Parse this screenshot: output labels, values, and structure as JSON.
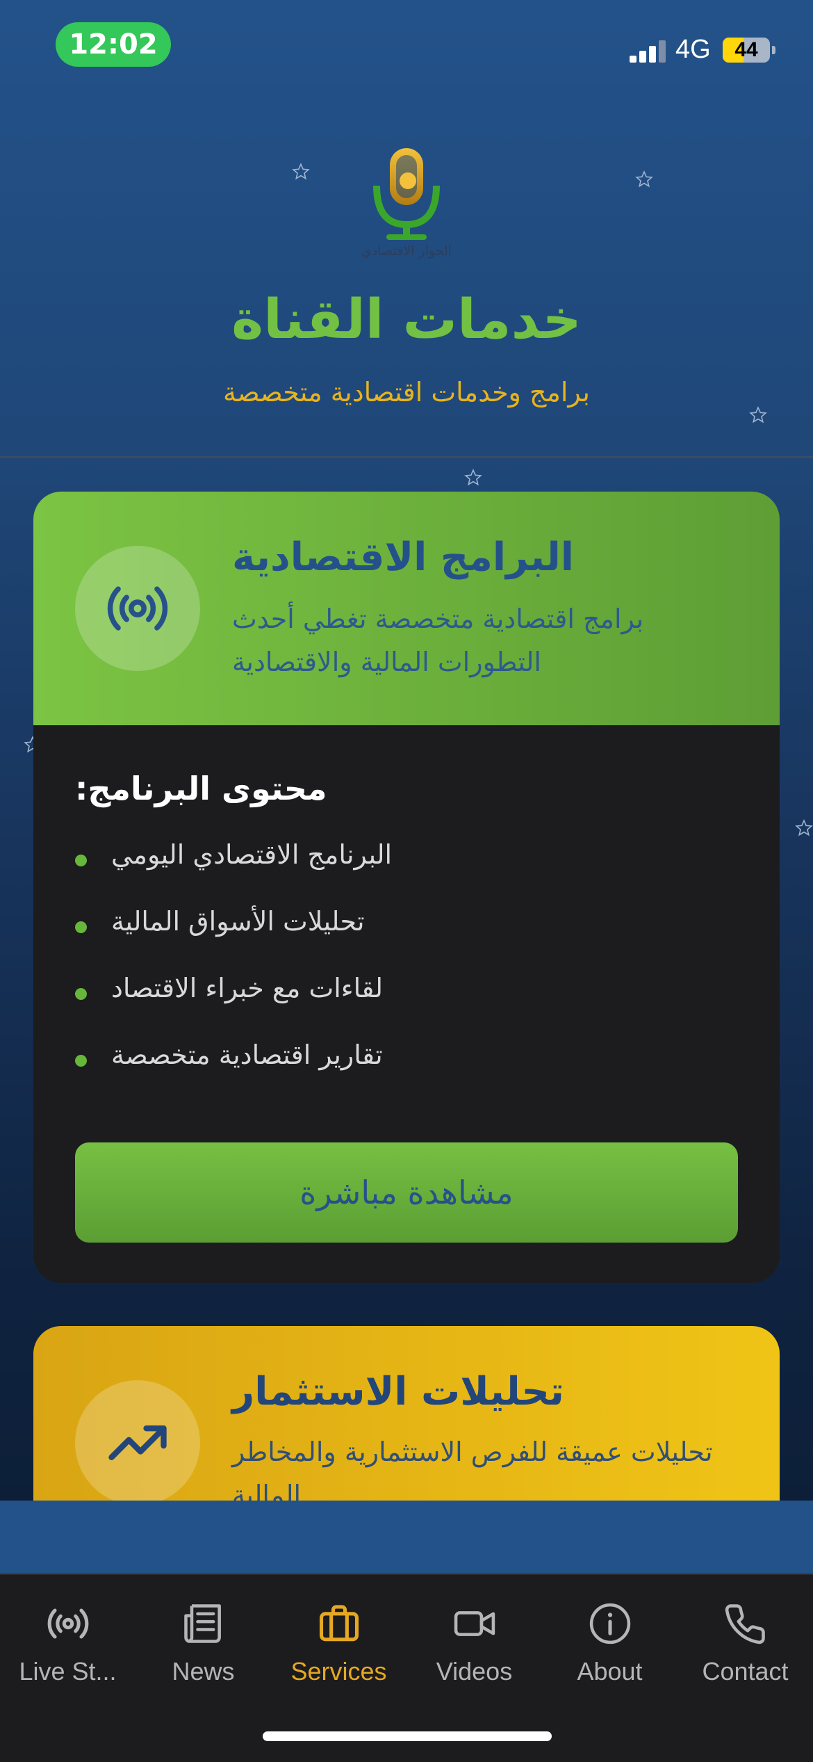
{
  "status_bar": {
    "time": "12:02",
    "network": "4G",
    "battery": "44",
    "battery_level": 0.44
  },
  "hero": {
    "logo_text": "الحوار الاقتصادي",
    "title": "خدمات القناة",
    "subtitle": "برامج وخدمات اقتصادية متخصصة"
  },
  "cards": [
    {
      "icon": "broadcast-icon",
      "title": "البرامج الاقتصادية",
      "description": "برامج اقتصادية متخصصة تغطي أحدث التطورات المالية والاقتصادية",
      "content_title": "محتوى البرنامج:",
      "items": [
        "البرنامج الاقتصادي اليومي",
        "تحليلات الأسواق المالية",
        "لقاءات مع خبراء الاقتصاد",
        "تقارير اقتصادية متخصصة"
      ],
      "button": "مشاهدة مباشرة"
    },
    {
      "icon": "trending-up-icon",
      "title": "تحليلات الاستثمار",
      "description": "تحليلات عميقة للفرص الاستثمارية والمخاطر المالية"
    }
  ],
  "tabs": [
    {
      "label": "Live St...",
      "icon": "broadcast-icon"
    },
    {
      "label": "News",
      "icon": "newspaper-icon"
    },
    {
      "label": "Services",
      "icon": "briefcase-icon",
      "active": true
    },
    {
      "label": "Videos",
      "icon": "video-camera-icon"
    },
    {
      "label": "About",
      "icon": "info-icon"
    },
    {
      "label": "Contact",
      "icon": "phone-icon"
    }
  ],
  "colors": {
    "accent_green": "#72c044",
    "accent_gold": "#e8b41c",
    "active_tab": "#e6a823",
    "background_blue": "#23528a"
  }
}
